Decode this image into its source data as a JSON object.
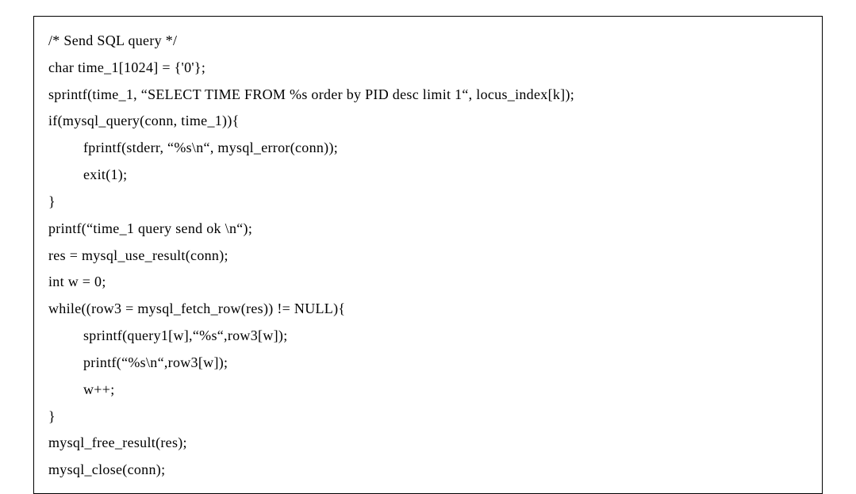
{
  "lines": [
    {
      "text": "/* Send SQL query */",
      "indent": false
    },
    {
      "text": "char time_1[1024] = {'0'};",
      "indent": false
    },
    {
      "text": "sprintf(time_1, “SELECT TIME FROM %s order by PID desc limit 1“, locus_index[k]);",
      "indent": false
    },
    {
      "text": "if(mysql_query(conn, time_1)){",
      "indent": false
    },
    {
      "text": "fprintf(stderr, “%s\\n“, mysql_error(conn));",
      "indent": true
    },
    {
      "text": "exit(1);",
      "indent": true
    },
    {
      "text": "}",
      "indent": false
    },
    {
      "text": "printf(“time_1 query send ok \\n“);",
      "indent": false
    },
    {
      "text": "res = mysql_use_result(conn);",
      "indent": false
    },
    {
      "text": "int w = 0;",
      "indent": false
    },
    {
      "text": "while((row3 = mysql_fetch_row(res)) != NULL){",
      "indent": false
    },
    {
      "text": "sprintf(query1[w],“%s“,row3[w]);",
      "indent": true
    },
    {
      "text": "printf(“%s\\n“,row3[w]);",
      "indent": true
    },
    {
      "text": "w++;",
      "indent": true
    },
    {
      "text": "}",
      "indent": false
    },
    {
      "text": "mysql_free_result(res);",
      "indent": false
    },
    {
      "text": "mysql_close(conn);",
      "indent": false
    }
  ]
}
